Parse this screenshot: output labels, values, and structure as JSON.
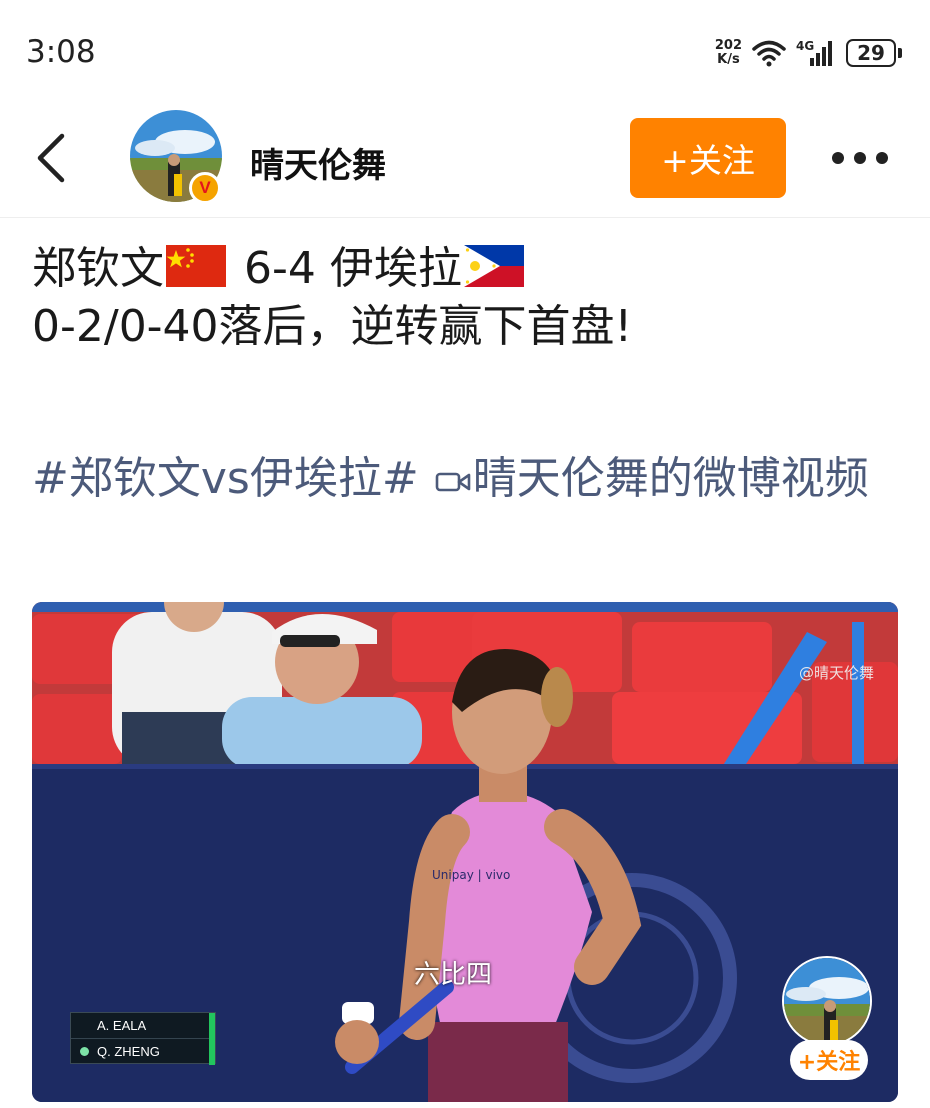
{
  "status_bar": {
    "time": "3:08",
    "net_speed_value": "202",
    "net_speed_unit": "K/s",
    "network": "4G",
    "battery": "29"
  },
  "header": {
    "username": "晴天伦舞",
    "verified_badge": "V",
    "follow_label": "+关注"
  },
  "post": {
    "player1": "郑钦文",
    "score": "6-4",
    "player2": "伊埃拉",
    "line2": "0-2/0-40落后，逆转赢下首盘!",
    "topic": "#郑钦文vs伊埃拉#",
    "video_link": "晴天伦舞的微博视频"
  },
  "video": {
    "watermark": "@晴天伦舞",
    "subtitle": "六比四",
    "scoreboard": [
      {
        "name": "A. EALA",
        "serving": false
      },
      {
        "name": "Q. ZHENG",
        "serving": true
      }
    ],
    "mini_follow_label": "+关注"
  },
  "colors": {
    "accent_orange": "#ff8200",
    "topic_link": "#4c5a7a",
    "court_blue": "#1d2b63"
  }
}
